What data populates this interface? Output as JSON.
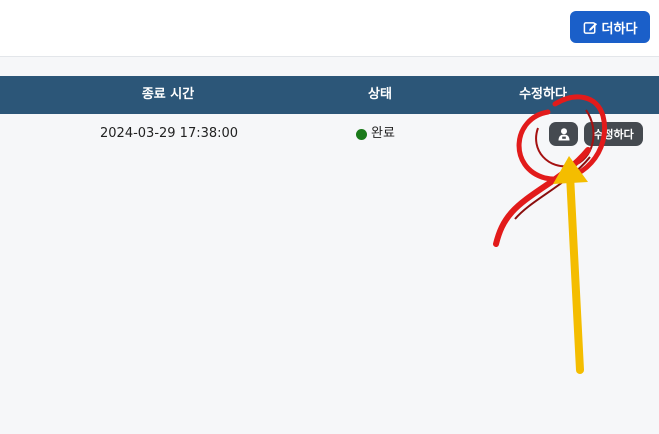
{
  "toolbar": {
    "add_label": "더하다",
    "add_icon": "edit-square-icon"
  },
  "table": {
    "headers": {
      "end_time": "종료 시간",
      "status": "상태",
      "edit": "수정하다"
    },
    "rows": [
      {
        "end_time": "2024-03-29 17:38:00",
        "status": "완료",
        "status_color": "#1a7a1a",
        "action_icon": "user-icon",
        "edit_label": "수정하다"
      }
    ]
  },
  "colors": {
    "header_bg": "#2c5678",
    "accent": "#1a5fc9",
    "action_bg": "#454a50"
  }
}
